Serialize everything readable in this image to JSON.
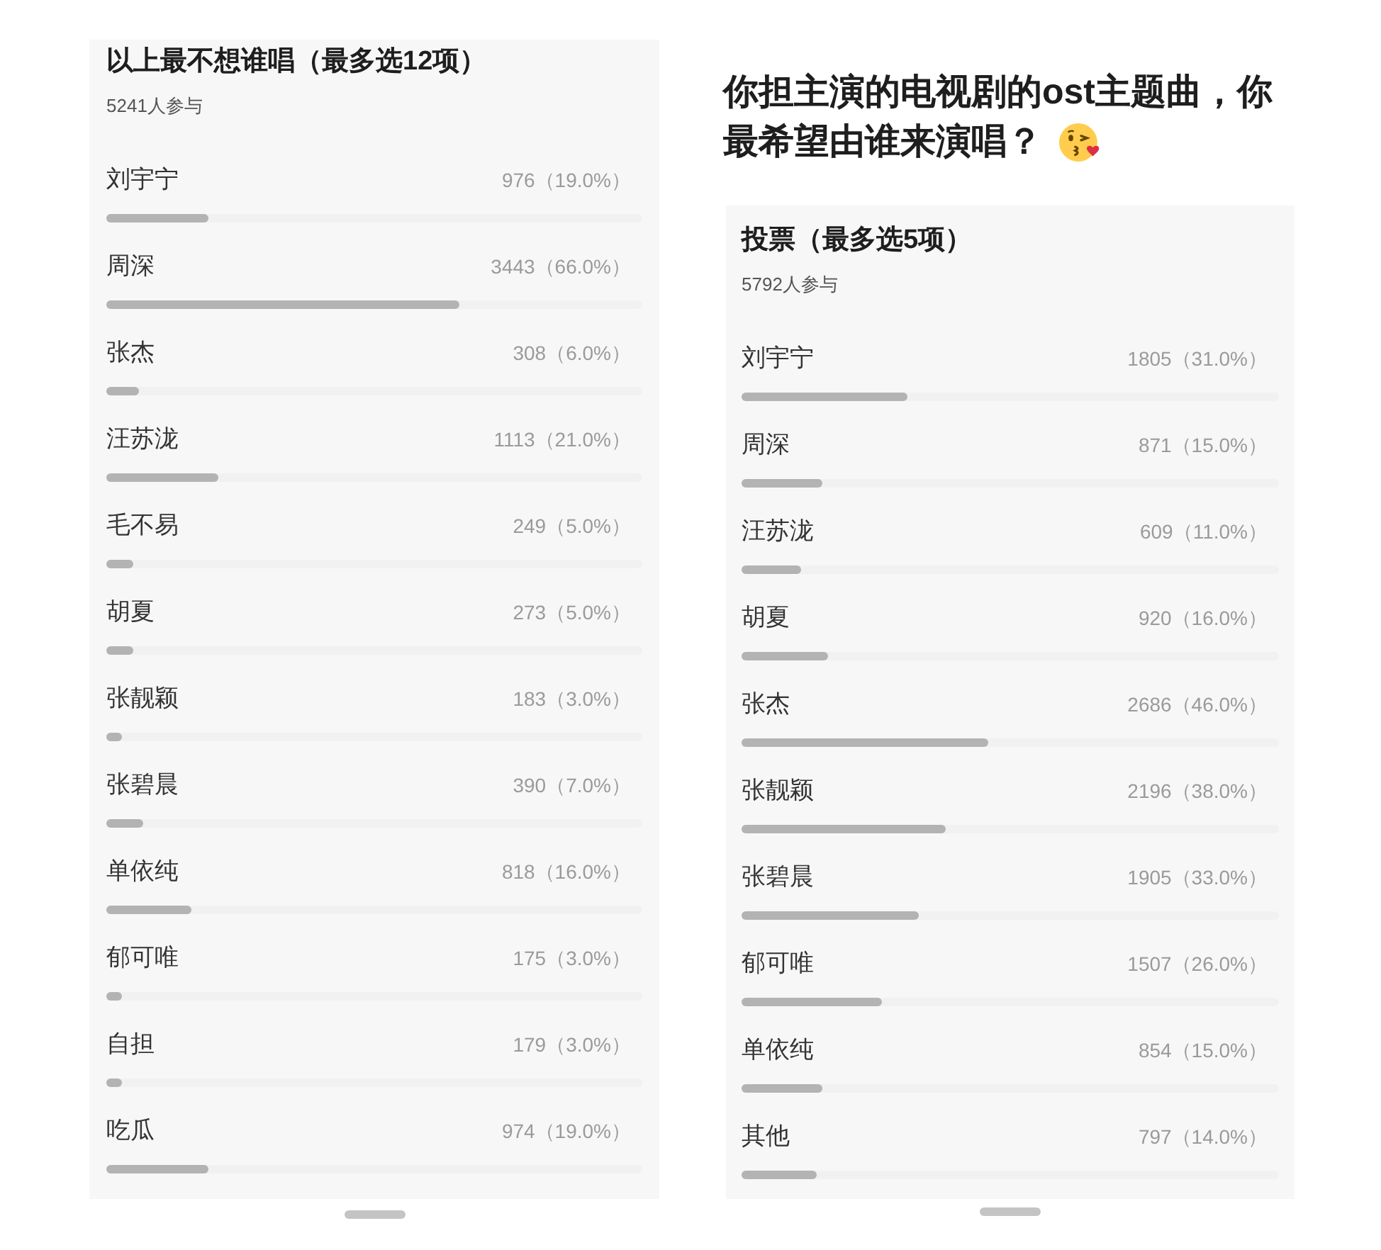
{
  "left_poll": {
    "title": "以上最不想谁唱（最多选12项）",
    "participants": "5241人参与",
    "options": [
      {
        "name": "刘宇宁",
        "result": "976（19.0%）",
        "level": 0.19
      },
      {
        "name": "周深",
        "result": "3443（66.0%）",
        "level": 0.66
      },
      {
        "name": "张杰",
        "result": "308（6.0%）",
        "level": 0.06
      },
      {
        "name": "汪苏泷",
        "result": "1113（21.0%）",
        "level": 0.21
      },
      {
        "name": "毛不易",
        "result": "249（5.0%）",
        "level": 0.05
      },
      {
        "name": "胡夏",
        "result": "273（5.0%）",
        "level": 0.05
      },
      {
        "name": "张靓颖",
        "result": "183（3.0%）",
        "level": 0.03
      },
      {
        "name": "张碧晨",
        "result": "390（7.0%）",
        "level": 0.07
      },
      {
        "name": "单依纯",
        "result": "818（16.0%）",
        "level": 0.16
      },
      {
        "name": "郁可唯",
        "result": "175（3.0%）",
        "level": 0.03
      },
      {
        "name": "自担",
        "result": "179（3.0%）",
        "level": 0.03
      },
      {
        "name": "吃瓜",
        "result": "974（19.0%）",
        "level": 0.19
      }
    ]
  },
  "right_post": {
    "question_lines": [
      "你担主演的电视剧的ost主题曲，你",
      "最希望由谁来演唱？"
    ],
    "poll": {
      "title": "投票（最多选5项）",
      "participants": "5792人参与",
      "options": [
        {
          "name": "刘宇宁",
          "result": "1805（31.0%）",
          "level": 0.31
        },
        {
          "name": "周深",
          "result": "871（15.0%）",
          "level": 0.15
        },
        {
          "name": "汪苏泷",
          "result": "609（11.0%）",
          "level": 0.11
        },
        {
          "name": "胡夏",
          "result": "920（16.0%）",
          "level": 0.16
        },
        {
          "name": "张杰",
          "result": "2686（46.0%）",
          "level": 0.46
        },
        {
          "name": "张靓颖",
          "result": "2196（38.0%）",
          "level": 0.38
        },
        {
          "name": "张碧晨",
          "result": "1905（33.0%）",
          "level": 0.33
        },
        {
          "name": "郁可唯",
          "result": "1507（26.0%）",
          "level": 0.26
        },
        {
          "name": "单依纯",
          "result": "854（15.0%）",
          "level": 0.15
        },
        {
          "name": "其他",
          "result": "797（14.0%）",
          "level": 0.14
        }
      ]
    }
  }
}
